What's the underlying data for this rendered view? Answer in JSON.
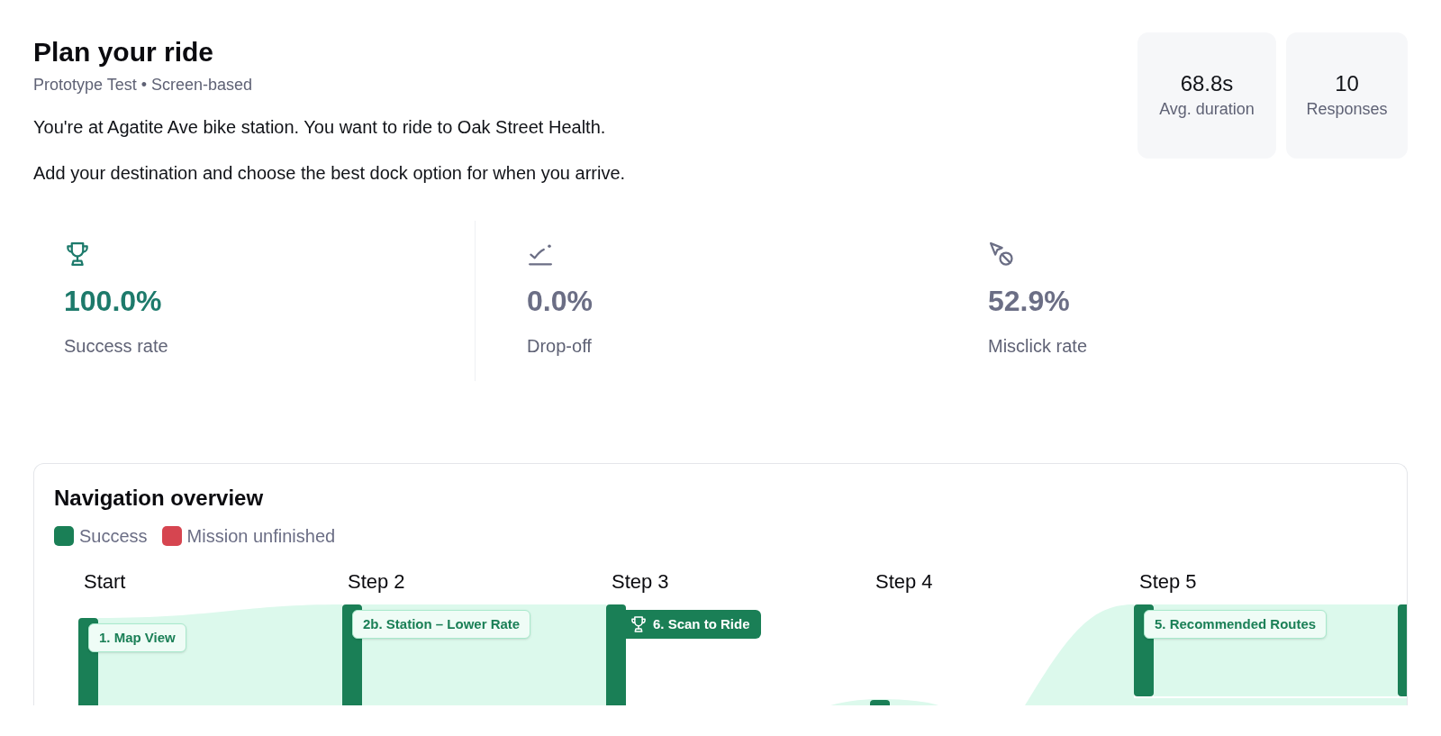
{
  "header": {
    "title": "Plan your ride",
    "subtitle": "Prototype Test • Screen-based",
    "description": [
      "You're at Agatite Ave bike station. You want to ride to Oak Street Health.",
      "Add your destination and choose the best dock option for when you arrive."
    ]
  },
  "summary_stats": [
    {
      "value": "68.8s",
      "label": "Avg. duration"
    },
    {
      "value": "10",
      "label": "Responses"
    }
  ],
  "metrics": [
    {
      "kind": "success",
      "value": "100.0%",
      "label": "Success rate"
    },
    {
      "kind": "drop_off",
      "value": "0.0%",
      "label": "Drop-off"
    },
    {
      "kind": "misclick",
      "value": "52.9%",
      "label": "Misclick rate"
    }
  ],
  "navigation_overview": {
    "title": "Navigation overview",
    "legend": [
      {
        "label": "Success",
        "color": "#1a7f56"
      },
      {
        "label": "Mission unfinished",
        "color": "#d64550"
      }
    ],
    "steps": [
      {
        "label": "Start",
        "nodes": [
          {
            "label": "1. Map View",
            "kind": "screen"
          }
        ]
      },
      {
        "label": "Step 2",
        "nodes": [
          {
            "label": "2b. Station – Lower Rate",
            "kind": "screen"
          }
        ]
      },
      {
        "label": "Step 3",
        "nodes": [
          {
            "label": "6. Scan to Ride",
            "kind": "goal"
          }
        ]
      },
      {
        "label": "Step 4"
      },
      {
        "label": "Step 5",
        "nodes": [
          {
            "label": "5. Recommended Routes",
            "kind": "screen"
          }
        ]
      }
    ]
  }
}
